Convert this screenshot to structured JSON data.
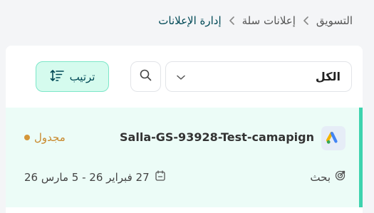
{
  "breadcrumb": {
    "items": [
      "التسويق",
      "إعلانات سلة",
      "إدارة الإعلانات"
    ]
  },
  "toolbar": {
    "filter_value": "الكل",
    "sort_label": "ترتيب"
  },
  "campaign": {
    "name": "Salla-GS-93928-Test-camapign",
    "status": "مجدول",
    "type": "بحث",
    "date_range": "27 فبراير 26 - 5 مارس 26",
    "brand_icon": "google-ads-icon"
  },
  "colors": {
    "accent": "#3ed3ae",
    "brand_dark": "#004956",
    "status": "#d4963a",
    "row_background": "#ecfcf7"
  }
}
